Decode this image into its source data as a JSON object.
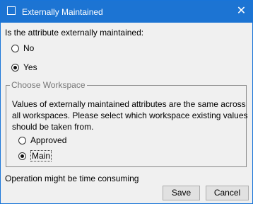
{
  "window": {
    "title": "Externally Maintained",
    "close_glyph": "✕"
  },
  "question": "Is the attribute externally maintained:",
  "maintained_options": [
    {
      "label": "No",
      "selected": false
    },
    {
      "label": "Yes",
      "selected": true
    }
  ],
  "workspace_group": {
    "legend": "Choose Workspace",
    "description": "Values of externally maintained attributes are the same across all workspaces. Please select which workspace existing values should be taken from.",
    "options": [
      {
        "label": "Approved",
        "selected": false
      },
      {
        "label": "Main",
        "selected": true
      }
    ]
  },
  "status_text": "Operation might be time consuming",
  "buttons": {
    "save": "Save",
    "cancel": "Cancel"
  },
  "colors": {
    "titlebar": "#1c74d3",
    "background": "#f0f0f0"
  }
}
